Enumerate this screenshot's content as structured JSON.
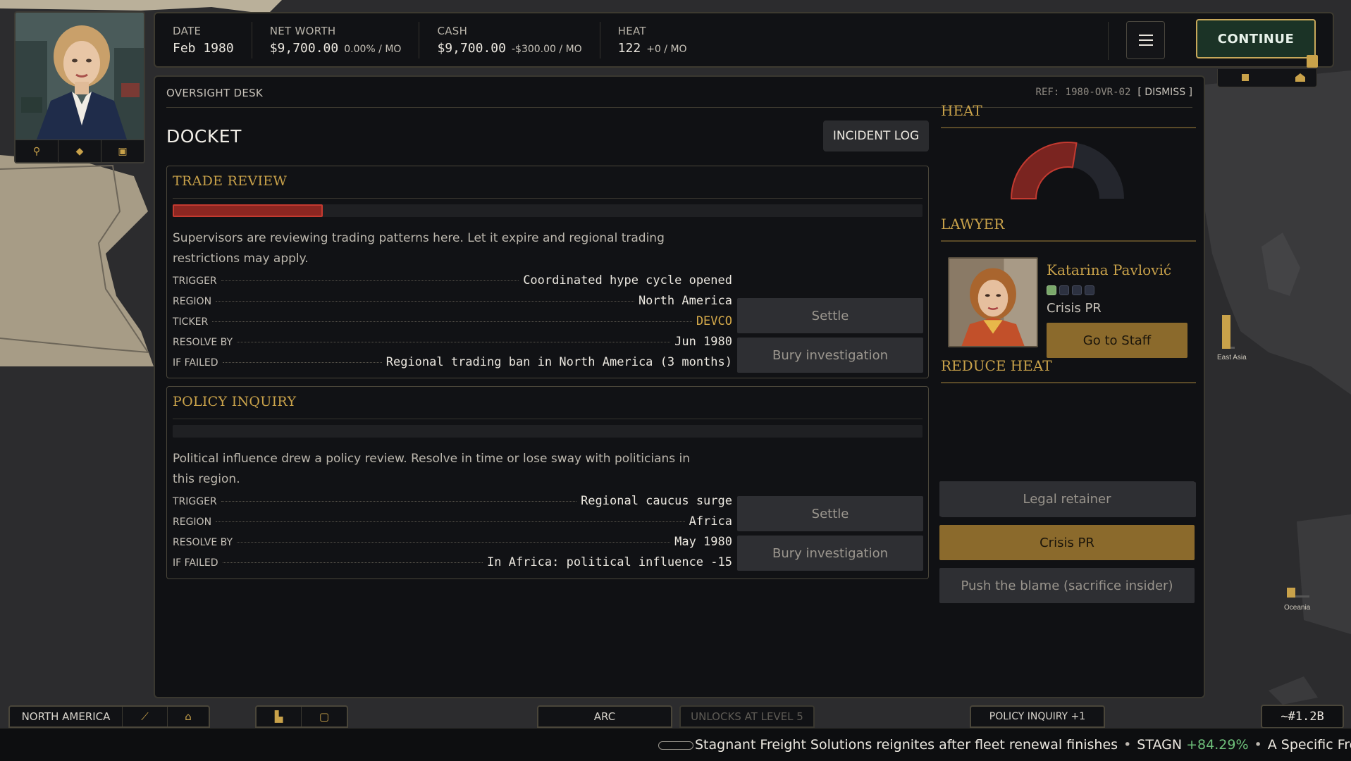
{
  "topbar": {
    "date": {
      "label": "DATE",
      "value": "Feb 1980"
    },
    "net_worth": {
      "label": "NET WORTH",
      "value": "$9,700.00",
      "delta": "0.00% / MO"
    },
    "cash": {
      "label": "CASH",
      "value": "$9,700.00",
      "delta": "-$300.00 / MO"
    },
    "heat": {
      "label": "HEAT",
      "value": "122",
      "delta": "+0 / MO"
    },
    "continue_label": "CONTINUE"
  },
  "panel": {
    "title": "OVERSIGHT DESK",
    "ref": "REF: 1980-OVR-02",
    "dismiss": "[ DISMISS ]",
    "docket_title": "DOCKET",
    "incident_log": "INCIDENT LOG"
  },
  "cases": [
    {
      "title": "TRADE REVIEW",
      "progress": 0.2,
      "description": "Supervisors are reviewing trading patterns here. Let it expire and regional trading restrictions may apply.",
      "rows": [
        {
          "key": "TRIGGER",
          "value": "Coordinated hype cycle opened"
        },
        {
          "key": "REGION",
          "value": "North America"
        },
        {
          "key": "TICKER",
          "value": "DEVCO"
        },
        {
          "key": "RESOLVE BY",
          "value": "Jun 1980"
        },
        {
          "key": "IF FAILED",
          "value": "Regional trading ban in North America (3 months)"
        }
      ],
      "settle": "Settle",
      "bury": "Bury investigation"
    },
    {
      "title": "POLICY INQUIRY",
      "progress": 0,
      "description": "Political influence drew a policy review. Resolve in time or lose sway with politicians in this region.",
      "rows": [
        {
          "key": "TRIGGER",
          "value": "Regional caucus surge"
        },
        {
          "key": "REGION",
          "value": "Africa"
        },
        {
          "key": "RESOLVE BY",
          "value": "May 1980"
        },
        {
          "key": "IF FAILED",
          "value": "In Africa: political influence -15"
        }
      ],
      "settle": "Settle",
      "bury": "Bury investigation"
    }
  ],
  "sidebar": {
    "heat_title": "HEAT",
    "heat_gauge_fraction": 0.55,
    "lawyer_title": "LAWYER",
    "lawyer_name": "Katarina Pavlović",
    "lawyer_level": 1,
    "lawyer_level_max": 4,
    "lawyer_role": "Crisis PR",
    "go_to_staff": "Go to Staff",
    "reduce_heat_title": "REDUCE HEAT",
    "reduce_options": [
      "Legal retainer",
      "Crisis PR",
      "Push the blame (sacrifice insider)"
    ]
  },
  "map": {
    "east_asia": "East Asia",
    "oceania": "Oceania"
  },
  "bottom": {
    "region_tab": "NORTH AMERICA",
    "arc_tab": "ARC",
    "unlock_tab": "UNLOCKS AT LEVEL 5",
    "policy_tab": "POLICY INQUIRY +1",
    "rank": "~#1.2B",
    "ticker_text": "Stagnant Freight Solutions reignites after fleet renewal finishes",
    "ticker_symbol": "STAGN",
    "ticker_change": "+84.29%",
    "ticker_next": "A Specific Freque"
  },
  "colors": {
    "accent": "#c9a24a",
    "danger": "#c43a30",
    "continue_bg": "#1b3326"
  }
}
